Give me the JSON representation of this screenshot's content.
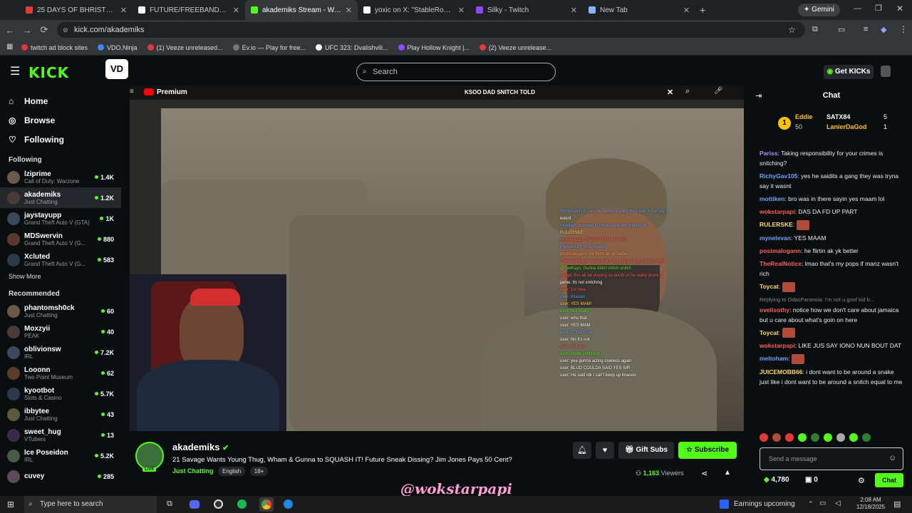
{
  "browser": {
    "tabs": [
      {
        "title": "25 DAYS OF BHRISTMAS",
        "color": "#e53935"
      },
      {
        "title": "FUTURE/FREEBANDZ (@1future",
        "color": "#ffffff"
      },
      {
        "title": "akademiks Stream - Watch",
        "color": "#53fc18",
        "active": true
      },
      {
        "title": "yoxic on X: \"StableRonaldo wa",
        "color": "#ffffff"
      },
      {
        "title": "Silky - Twitch",
        "color": "#9146ff"
      },
      {
        "title": "New Tab",
        "color": "#8ab4f8"
      }
    ],
    "gemini_label": "Gemini",
    "url": "kick.com/akademiks",
    "bookmarks": [
      {
        "label": "twitch ad block sites",
        "color": "#e53935"
      },
      {
        "label": "VDO.Ninja",
        "color": "#4285f4"
      },
      {
        "label": "(1) Veeze unreleased...",
        "color": "#e53935"
      },
      {
        "label": "Ev.io — Play for free...",
        "color": "#777777"
      },
      {
        "label": "UFC 323: Dvalishvili...",
        "color": "#ffffff"
      },
      {
        "label": "Play Hollow Knight |...",
        "color": "#9146ff"
      },
      {
        "label": "(2) Veeze unrelease...",
        "color": "#e53935"
      }
    ]
  },
  "header": {
    "logo": "KICK",
    "search_placeholder": "Search",
    "get_kicks": "Get KICKs",
    "accent": "#53fc18"
  },
  "sidebar": {
    "nav": [
      {
        "label": "Home",
        "icon": "home-icon"
      },
      {
        "label": "Browse",
        "icon": "compass-icon"
      },
      {
        "label": "Following",
        "icon": "heart-icon"
      }
    ],
    "following_title": "Following",
    "following": [
      {
        "name": "lziprime",
        "game": "Call of Duty: Warzone",
        "viewers": "1.4K"
      },
      {
        "name": "akademiks",
        "game": "Just Chatting",
        "viewers": "1.2K"
      },
      {
        "name": "jaystayupp",
        "game": "Grand Theft Auto V (GTA)",
        "viewers": "1K"
      },
      {
        "name": "MDSwervin",
        "game": "Grand Theft Auto V (G...",
        "viewers": "880"
      },
      {
        "name": "Xcluted",
        "game": "Grand Theft Auto V (G...",
        "viewers": "583"
      }
    ],
    "show_more": "Show More",
    "recommended_title": "Recommended",
    "recommended": [
      {
        "name": "phantomsh0ck",
        "game": "Just Chatting",
        "viewers": "60"
      },
      {
        "name": "Moxzyii",
        "game": "PEAK",
        "viewers": "40"
      },
      {
        "name": "oblivionsw",
        "game": "IRL",
        "viewers": "7.2K"
      },
      {
        "name": "Looonn",
        "game": "Two Point Museum",
        "viewers": "62"
      },
      {
        "name": "kyootbot",
        "game": "Slots & Casino",
        "viewers": "5.7K"
      },
      {
        "name": "ibbytee",
        "game": "Just Chatting",
        "viewers": "43"
      },
      {
        "name": "sweet_hug",
        "game": "VTubers",
        "viewers": "13"
      },
      {
        "name": "Ice Poseidon",
        "game": "IRL",
        "viewers": "5.2K"
      },
      {
        "name": "cuvey",
        "game": "",
        "viewers": "285"
      }
    ]
  },
  "video": {
    "yt_brand": "Premium",
    "yt_search": "KSOO DAD SNITCH TOLD",
    "overlay_chat": [
      "RichyGav105: yes he saidits a gang they was tryna say it",
      "wasnt",
      "mottiken: bro was in there sayin yes maam lol",
      "RULERSKE: ",
      "wokstarpapi: DAS DA FD UP PART",
      "mynelevan: YES MAAM",
      "postmalogann: he flirtin ak yk better",
      "TheRealNotice: lmao that's my pops if manz wasn't rich",
      "@TeeKays: Gunna didnt snitch snitch",
      "@bgd: Bro ak be playing so dumb or he really drunk fr",
      "jamie: Its not snitching",
      "user: 1st time",
      "user: lmaooo",
      "user: YES MAM!",
      "user: Not really",
      "user: who that",
      "user: YES MAM",
      "user: STOP IT ak",
      "user: No it's not",
      "user: hell yea",
      "user: Polite snitching",
      "user: yea gunna acting clueless again",
      "user: BLUD COULDA SAID YES SIR",
      "user: He said idk I can't keep up lmaooo"
    ]
  },
  "stream": {
    "streamer": "akademiks",
    "title": "21 Savage Wants Young Thug, Wham & Gunna to SQUASH IT! Future Sneak Dissing? Jim Jones Pays 50 Cent?",
    "category": "Just Chatting",
    "tags": [
      "English",
      "18+"
    ],
    "live_badge": "LIVE",
    "gift_subs": "Gift Subs",
    "subscribe": "Subscribe",
    "viewers": "1,163",
    "viewers_label": "Viewers"
  },
  "chat": {
    "title": "Chat",
    "leaderboard": [
      {
        "name": "Eddie",
        "count": "50",
        "rank": "1"
      },
      {
        "name": "SATX84",
        "count": "5"
      },
      {
        "name": "LanierDaGod",
        "count": "1"
      }
    ],
    "messages": [
      {
        "user": "Pariss",
        "color": "#b48cff",
        "text": "Taking responsibility for your crimes is snitching?"
      },
      {
        "user": "RichyGav105",
        "color": "#6da4ff",
        "text": "yes he saidits a gang they was tryna say it wasnt"
      },
      {
        "user": "mottiken",
        "color": "#6da4ff",
        "text": "bro was in there sayin yes maam lol"
      },
      {
        "user": "wokstarpapi",
        "color": "#ff5c5c",
        "text": "DAS DA FD UP PART"
      },
      {
        "user": "RULERSKE",
        "color": "#ffd966",
        "text": ""
      },
      {
        "user": "mynelevan",
        "color": "#6da4ff",
        "text": "YES MAAM"
      },
      {
        "user": "postmalogann",
        "color": "#ff5c5c",
        "text": "he flirtin ak yk better"
      },
      {
        "user": "TheRealNotice",
        "color": "#ff5c5c",
        "text": "lmao that's my pops if manz wasn't rich"
      },
      {
        "user": "Toycat",
        "color": "#ffd966",
        "text": ""
      },
      {
        "reply": "Replying to OdasParanoia: I'm not u goof kid b..."
      },
      {
        "user": "ovelisothy",
        "color": "#ff5c5c",
        "text": "notice how we don't care about jamaica but u care about what's goin on here"
      },
      {
        "user": "Toycat",
        "color": "#ffd966",
        "text": ""
      },
      {
        "user": "wokstarpapi",
        "color": "#ff5c5c",
        "text": "LIKE JUS SAY IONO NUN BOUT DAT"
      },
      {
        "user": "meltoham",
        "color": "#6da4ff",
        "text": ""
      },
      {
        "user": "JUICEMOBB66",
        "color": "#ffd966",
        "text": "i dont want to be around a snake just like i dont want to be around a snitch equal to me"
      }
    ],
    "input_placeholder": "Send a message",
    "kicks_count": "4,780",
    "other_count": "0",
    "send_label": "Chat"
  },
  "taskbar": {
    "search_placeholder": "Type here to search",
    "weather": "Earnings upcoming",
    "time": "2:08 AM",
    "date": "12/18/2025"
  },
  "watermark": "@wokstarpapi"
}
